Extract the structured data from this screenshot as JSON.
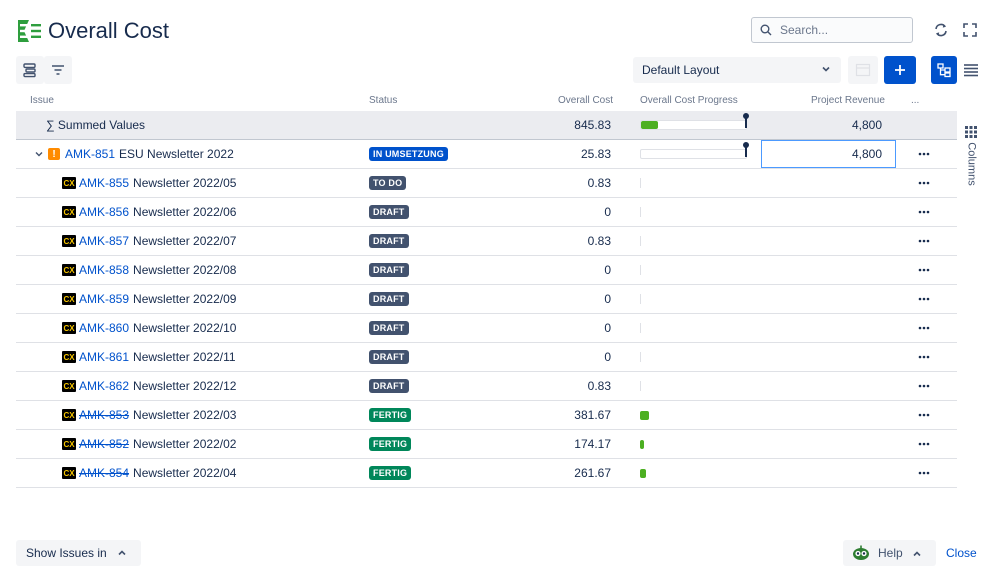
{
  "header": {
    "title": "Overall Cost",
    "search_placeholder": "Search..."
  },
  "toolbar": {
    "layout_select": "Default Layout"
  },
  "columns": {
    "issue": "Issue",
    "status": "Status",
    "overall_cost": "Overall Cost",
    "progress": "Overall Cost Progress",
    "revenue": "Project Revenue",
    "more": "...",
    "side_tab": "Columns"
  },
  "summary": {
    "label": "∑ Summed Values",
    "overall_cost": "845.83",
    "progress": 0.16,
    "revenue": "4,800"
  },
  "parent": {
    "key": "AMK-851",
    "summary": "ESU Newsletter 2022",
    "status": "IN UMSETZUNG",
    "overall_cost": "25.83",
    "progress": 0.0,
    "revenue": "4,800"
  },
  "rows": [
    {
      "key": "AMK-855",
      "summary": "Newsletter 2022/05",
      "status": "TO DO",
      "status_color": "grey",
      "overall_cost": "0.83",
      "done": false,
      "progress": 0.0
    },
    {
      "key": "AMK-856",
      "summary": "Newsletter 2022/06",
      "status": "DRAFT",
      "status_color": "grey",
      "overall_cost": "0",
      "done": false,
      "progress": 0.0
    },
    {
      "key": "AMK-857",
      "summary": "Newsletter 2022/07",
      "status": "DRAFT",
      "status_color": "grey",
      "overall_cost": "0.83",
      "done": false,
      "progress": 0.0
    },
    {
      "key": "AMK-858",
      "summary": "Newsletter 2022/08",
      "status": "DRAFT",
      "status_color": "grey",
      "overall_cost": "0",
      "done": false,
      "progress": 0.0
    },
    {
      "key": "AMK-859",
      "summary": "Newsletter 2022/09",
      "status": "DRAFT",
      "status_color": "grey",
      "overall_cost": "0",
      "done": false,
      "progress": 0.0
    },
    {
      "key": "AMK-860",
      "summary": "Newsletter 2022/10",
      "status": "DRAFT",
      "status_color": "grey",
      "overall_cost": "0",
      "done": false,
      "progress": 0.0
    },
    {
      "key": "AMK-861",
      "summary": "Newsletter 2022/11",
      "status": "DRAFT",
      "status_color": "grey",
      "overall_cost": "0",
      "done": false,
      "progress": 0.0
    },
    {
      "key": "AMK-862",
      "summary": "Newsletter 2022/12",
      "status": "DRAFT",
      "status_color": "grey",
      "overall_cost": "0.83",
      "done": false,
      "progress": 0.0
    },
    {
      "key": "AMK-853",
      "summary": "Newsletter 2022/03",
      "status": "FERTIG",
      "status_color": "green",
      "overall_cost": "381.67",
      "done": true,
      "progress": 0.08
    },
    {
      "key": "AMK-852",
      "summary": "Newsletter 2022/02",
      "status": "FERTIG",
      "status_color": "green",
      "overall_cost": "174.17",
      "done": true,
      "progress": 0.04
    },
    {
      "key": "AMK-854",
      "summary": "Newsletter 2022/04",
      "status": "FERTIG",
      "status_color": "green",
      "overall_cost": "261.67",
      "done": true,
      "progress": 0.06
    }
  ],
  "footer": {
    "show_issues": "Show Issues in",
    "help": "Help",
    "close": "Close"
  },
  "colors": {
    "accent": "#0052cc",
    "progress_fill": "#4caf21",
    "status_in_progress": "#0052cc",
    "status_default": "#42526e",
    "status_done": "#00875a"
  }
}
